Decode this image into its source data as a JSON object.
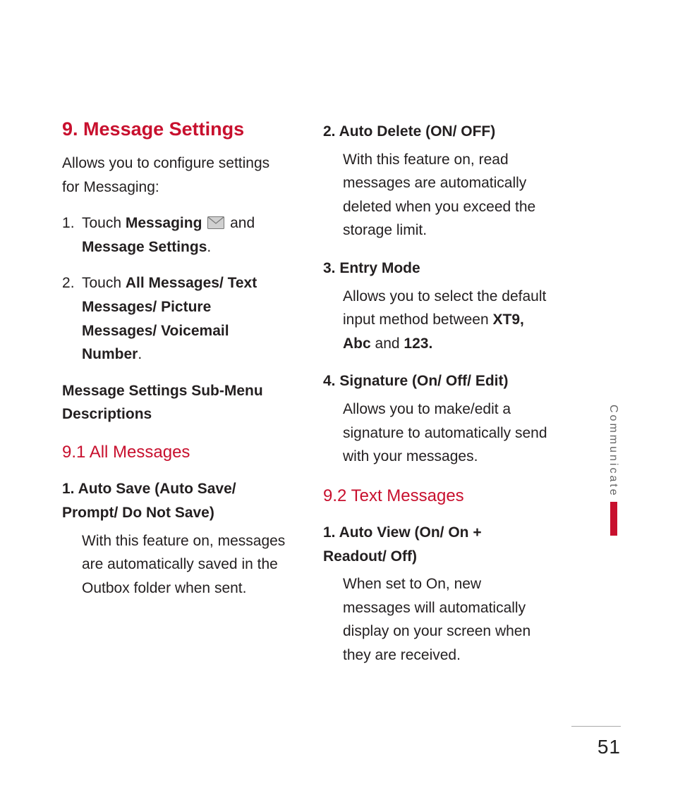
{
  "section": {
    "number": "9.",
    "title": "Message Settings",
    "intro": "Allows you to configure settings for Messaging:"
  },
  "steps": {
    "s1_pre": "Touch ",
    "s1_bold1": "Messaging",
    "s1_mid": " and ",
    "s1_bold2": "Message Settings",
    "s1_post": ".",
    "s2_pre": "Touch ",
    "s2_bold": "All Messages/ Text Messages/ Picture Messages/ Voicemail Number",
    "s2_post": "."
  },
  "submenu_heading": "Message Settings Sub-Menu Descriptions",
  "sub_9_1": {
    "title": "9.1 All Messages",
    "items": {
      "i1_head": "1. Auto Save (Auto Save/ Prompt/ Do Not Save)",
      "i1_body": "With this feature on, messages are automatically saved in the Outbox folder when sent.",
      "i2_head": "2. Auto Delete (ON/ OFF)",
      "i2_body": "With this feature on, read messages are automatically deleted when you exceed the storage limit.",
      "i3_head": "3. Entry Mode",
      "i3_body_pre": "Allows you to select the default input method between ",
      "i3_body_bold1": "XT9, Abc",
      "i3_body_mid": " and ",
      "i3_body_bold2": "123.",
      "i4_head": "4. Signature (On/ Off/ Edit)",
      "i4_body": "Allows you to make/edit a signature to automatically send with your messages."
    }
  },
  "sub_9_2": {
    "title": "9.2 Text Messages",
    "items": {
      "i1_head": "1. Auto View (On/ On + Readout/ Off)",
      "i1_body": "When set to On, new messages will automatically display on your screen when they are received."
    }
  },
  "side_tab": "Communicate",
  "page_number": "51"
}
